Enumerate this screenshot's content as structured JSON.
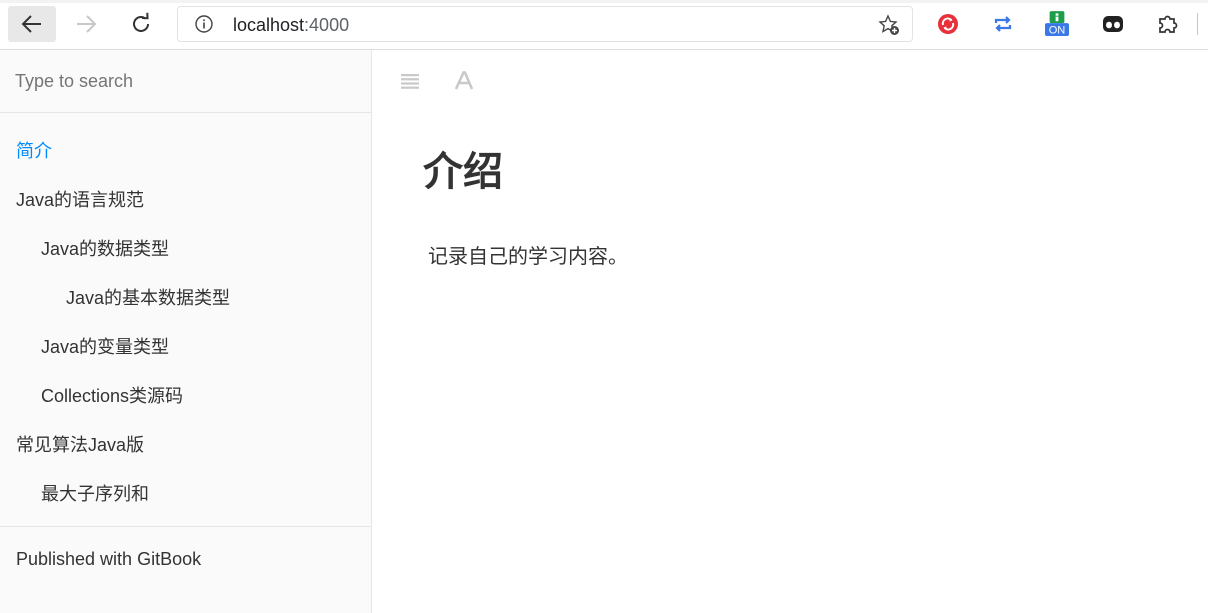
{
  "browser": {
    "url_host": "localhost",
    "url_port": ":4000",
    "extensions": [
      "sync-icon",
      "repeat-icon",
      "on-badge-extension-icon",
      "mask-icon",
      "puzzle-icon"
    ],
    "ext_badge": "ON"
  },
  "sidebar": {
    "search_placeholder": "Type to search",
    "items": [
      {
        "label": "简介",
        "level": 0,
        "active": true
      },
      {
        "label": "Java的语言规范",
        "level": 0,
        "active": false
      },
      {
        "label": "Java的数据类型",
        "level": 1,
        "active": false
      },
      {
        "label": "Java的基本数据类型",
        "level": 2,
        "active": false
      },
      {
        "label": "Java的变量类型",
        "level": 1,
        "active": false
      },
      {
        "label": "Collections类源码",
        "level": 1,
        "active": false
      },
      {
        "label": "常见算法Java版",
        "level": 0,
        "active": false
      },
      {
        "label": "最大子序列和",
        "level": 1,
        "active": false
      }
    ],
    "published": "Published with GitBook"
  },
  "content": {
    "title": "介绍",
    "text": "记录自己的学习内容。"
  },
  "colors": {
    "active_link": "#008cff",
    "sidebar_bg": "#fafafa",
    "text": "#333333"
  }
}
